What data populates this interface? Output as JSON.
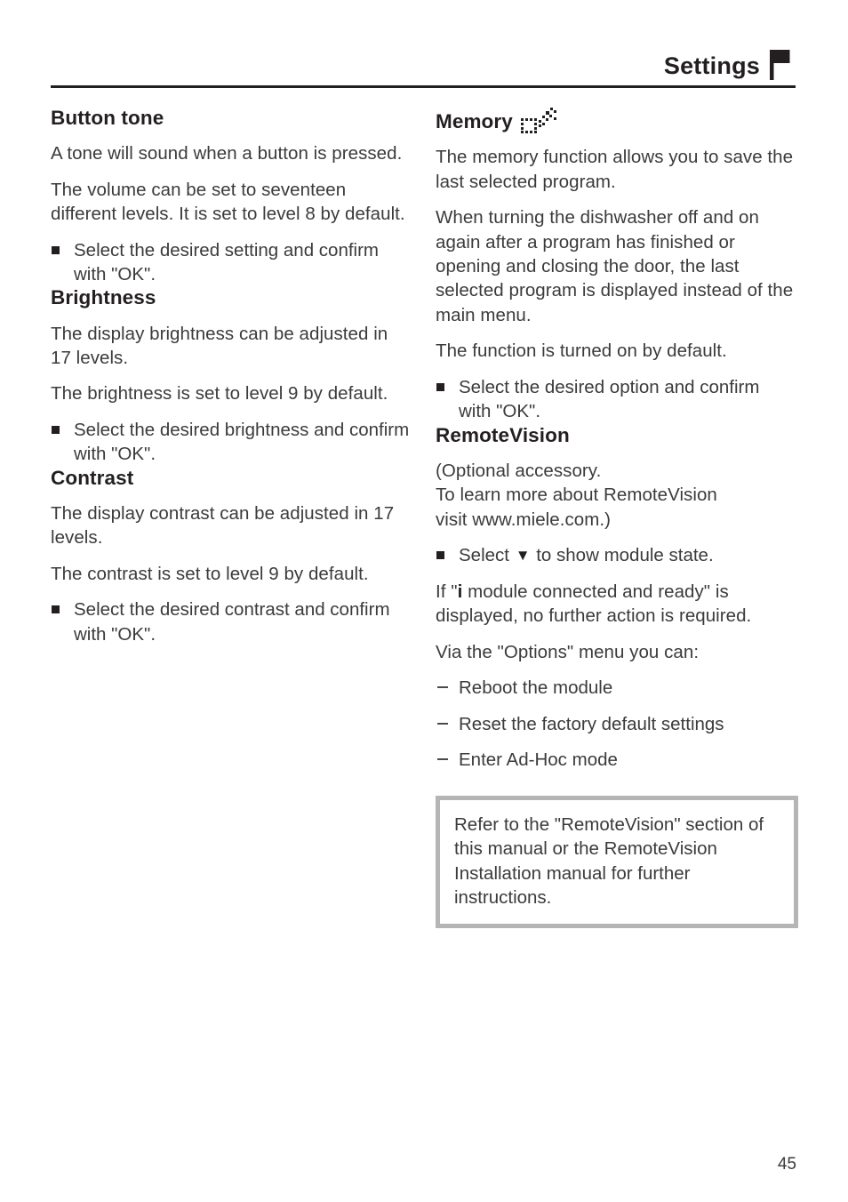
{
  "header": {
    "title": "Settings",
    "icon": "flag-icon"
  },
  "left_column": {
    "sections": [
      {
        "heading": "Button tone",
        "paragraphs": [
          "A tone will sound when a button is pressed.",
          "The volume can be set to seventeen different levels. It is set to level 8 by default."
        ],
        "bullets": [
          "Select the desired setting and confirm with \"OK\"."
        ]
      },
      {
        "heading": "Brightness",
        "paragraphs": [
          "The display brightness can be adjusted in 17 levels.",
          "The brightness is set to level 9 by default."
        ],
        "bullets": [
          "Select the desired brightness and confirm with \"OK\"."
        ]
      },
      {
        "heading": "Contrast",
        "paragraphs": [
          "The display contrast can be adjusted in 17 levels.",
          "The contrast is set to level 9 by default."
        ],
        "bullets": [
          "Select the desired contrast and confirm with \"OK\"."
        ]
      }
    ]
  },
  "right_column": {
    "memory": {
      "heading": "Memory",
      "heading_icon": "memory-icon",
      "paragraphs": [
        "The memory function allows you to save the last selected program.",
        "When turning the dishwasher off and on again after a program has finished or opening and closing the door, the last selected program is displayed instead of the main menu.",
        "The function is turned on by default."
      ],
      "bullets": [
        "Select the desired option and confirm with \"OK\"."
      ]
    },
    "remotevision": {
      "heading": "RemoteVision",
      "intro_lines": [
        "(Optional accessory.",
        "To learn more about RemoteVision",
        "visit www.miele.com.)"
      ],
      "select_bullet": {
        "prefix": "Select",
        "glyph": "▼",
        "suffix": "to show module state."
      },
      "status_paragraph": {
        "prefix": "If \"",
        "info_glyph": "i",
        "suffix": " module connected and ready\" is displayed, no further action is required."
      },
      "options_intro": "Via the \"Options\" menu you can:",
      "options": [
        "Reboot the module",
        "Reset the factory default settings",
        "Enter Ad-Hoc mode"
      ],
      "note": "Refer to the \"RemoteVision\" section of this manual or the RemoteVision Installation manual for further instructions."
    }
  },
  "footer": {
    "page_number": "45"
  },
  "colors": {
    "text": "#231f20",
    "body_text": "#3b3b3b",
    "rule": "#231f20",
    "note_border": "#b5b5b5"
  }
}
